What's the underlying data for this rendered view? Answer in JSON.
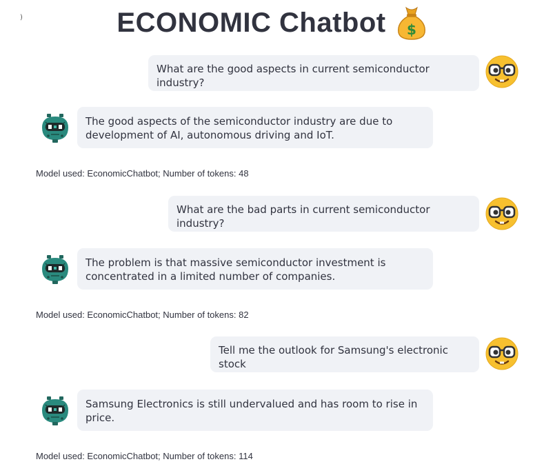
{
  "header": {
    "stray_mark": ")",
    "title": "ECONOMIC Chatbot",
    "title_icon": "money-bag-icon"
  },
  "messages": [
    {
      "role": "user",
      "text": "What are the good aspects in current semiconductor industry?",
      "avatar": "nerd-face-icon"
    },
    {
      "role": "assistant",
      "text_lines": [
        "The good aspects of the semiconductor industry are due to",
        "development of AI, autonomous driving and IoT."
      ],
      "avatar": "robot-icon",
      "meta": "Model used: EconomicChatbot; Number of tokens: 48"
    },
    {
      "role": "user",
      "text": "What are the bad parts in current semiconductor industry?",
      "avatar": "nerd-face-icon"
    },
    {
      "role": "assistant",
      "text_lines": [
        "The problem is that massive semiconductor investment is",
        "concentrated in a limited number of companies."
      ],
      "avatar": "robot-icon",
      "meta": "Model used: EconomicChatbot; Number of tokens: 82"
    },
    {
      "role": "user",
      "text": "Tell me the outlook for Samsung's electronic stock",
      "avatar": "nerd-face-icon"
    },
    {
      "role": "assistant",
      "text_lines": [
        "Samsung Electronics is still undervalued and has room to rise in",
        "price."
      ],
      "avatar": "robot-icon",
      "meta": "Model used: EconomicChatbot; Number of tokens: 114"
    }
  ],
  "colors": {
    "bubble_background": "#f0f2f6",
    "text": "#31333f",
    "user_avatar": "#f7c02f",
    "bot_avatar": "#2a8a7e"
  }
}
